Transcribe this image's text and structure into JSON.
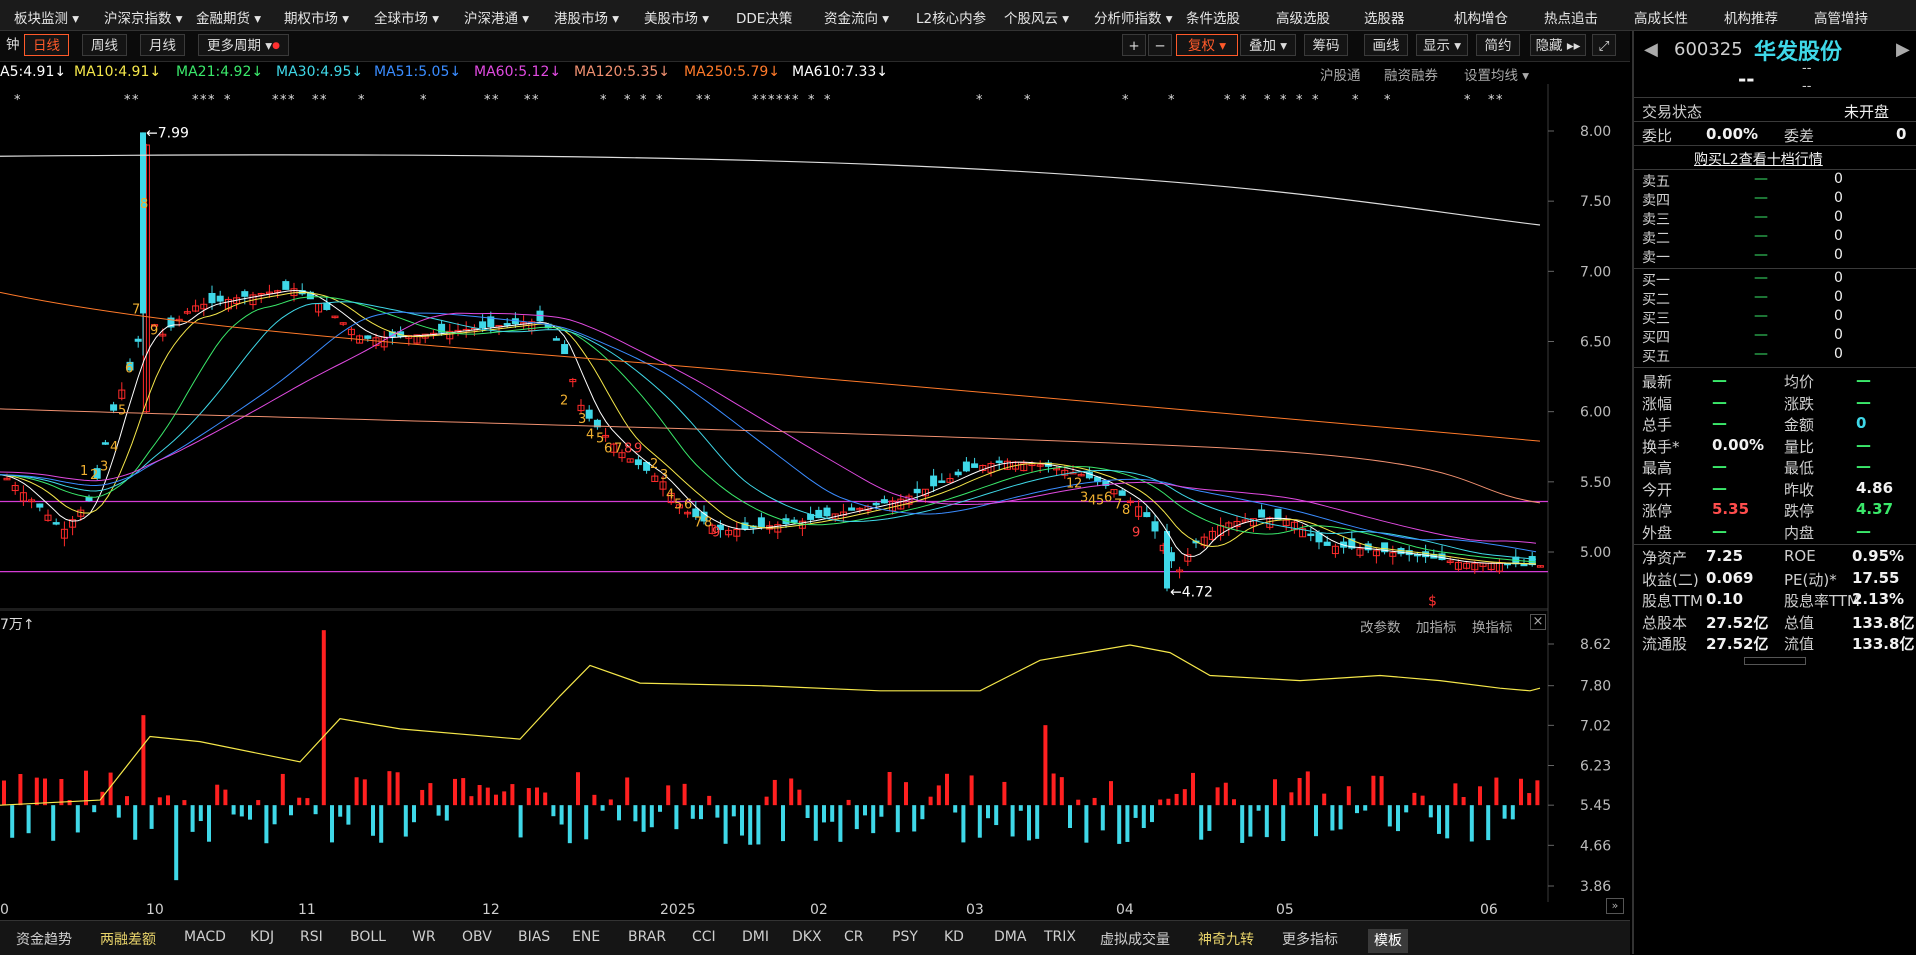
{
  "top_menu": [
    "板块监测",
    "沪深京指数",
    "金融期货",
    "期权市场",
    "全球市场",
    "沪深港通",
    "港股市场",
    "美股市场",
    "DDE决策",
    "资金流向",
    "L2核心内参",
    "个股风云",
    "分析师指数",
    "条件选股",
    "高级选股",
    "选股器",
    "机构增仓",
    "热点追击",
    "高成长性",
    "机构推荐",
    "高管增持"
  ],
  "period_bar": {
    "cut_label": "钟",
    "day": "日线",
    "week": "周线",
    "month": "月线",
    "more": "更多周期",
    "plus": "+",
    "minus": "−",
    "fuquan": "复权",
    "overlay": "叠加",
    "chips": "筹码",
    "draw": "画线",
    "display": "显示",
    "simple": "简约",
    "hide": "隐藏",
    "expand_icon": "expand-icon"
  },
  "ma_legend": [
    {
      "text": "A5:4.91↓",
      "color": "#ffffff"
    },
    {
      "text": "MA10:4.91↓",
      "color": "#f5e74a"
    },
    {
      "text": "MA21:4.92↓",
      "color": "#3ae86a"
    },
    {
      "text": "MA30:4.95↓",
      "color": "#3fd8e8"
    },
    {
      "text": "MA51:5.05↓",
      "color": "#3a8cff"
    },
    {
      "text": "MA60:5.12↓",
      "color": "#e04ae0"
    },
    {
      "text": "MA120:5.35↓",
      "color": "#f09070"
    },
    {
      "text": "MA250:5.79↓",
      "color": "#ff7a2a"
    },
    {
      "text": "MA610:7.33↓",
      "color": "#ffffff"
    }
  ],
  "chart_links": {
    "hkconnect": "沪股通",
    "margin": "融资融券",
    "set_ma": "设置均线"
  },
  "main_chart": {
    "y_ticks": [
      "8.00",
      "7.50",
      "7.00",
      "6.50",
      "6.00",
      "5.50",
      "5.00"
    ],
    "high_label": "←7.99",
    "low_label": "←4.72",
    "s_marker": "$"
  },
  "sub_chart": {
    "title": "7万↑",
    "y_ticks": [
      "8.62",
      "7.80",
      "7.02",
      "6.23",
      "5.45",
      "4.66",
      "3.86"
    ],
    "params": "改参数",
    "add_indicator": "加指标",
    "switch_indicator": "换指标",
    "close": "×"
  },
  "x_axis": [
    "0",
    "10",
    "11",
    "12",
    "2025",
    "02",
    "03",
    "04",
    "05",
    "06"
  ],
  "bottom_tabs": [
    "资金趋势",
    "两融差额",
    "MACD",
    "KDJ",
    "RSI",
    "BOLL",
    "WR",
    "OBV",
    "BIAS",
    "ENE",
    "BRAR",
    "CCI",
    "DMI",
    "DKX",
    "CR",
    "PSY",
    "KD",
    "DMA",
    "TRIX",
    "虚拟成交量",
    "神奇九转",
    "更多指标",
    "模板"
  ],
  "stock": {
    "code": "600325",
    "name": "华发股份",
    "price": "--",
    "change": "--",
    "pct": "--",
    "trade_status_label": "交易状态",
    "trade_status": "未开盘",
    "weibi_label": "委比",
    "weibi": "0.00%",
    "weicha_label": "委差",
    "weicha": "0",
    "buy_l2": "购买L2查看十档行情",
    "sell_levels": [
      {
        "label": "卖五",
        "price": "—",
        "vol": "0"
      },
      {
        "label": "卖四",
        "price": "—",
        "vol": "0"
      },
      {
        "label": "卖三",
        "price": "—",
        "vol": "0"
      },
      {
        "label": "卖二",
        "price": "—",
        "vol": "0"
      },
      {
        "label": "卖一",
        "price": "—",
        "vol": "0"
      }
    ],
    "buy_levels": [
      {
        "label": "买一",
        "price": "—",
        "vol": "0"
      },
      {
        "label": "买二",
        "price": "—",
        "vol": "0"
      },
      {
        "label": "买三",
        "price": "—",
        "vol": "0"
      },
      {
        "label": "买四",
        "price": "—",
        "vol": "0"
      },
      {
        "label": "买五",
        "price": "—",
        "vol": "0"
      }
    ],
    "stats": [
      {
        "l1": "最新",
        "v1": "—",
        "l2": "均价",
        "v2": "—"
      },
      {
        "l1": "涨幅",
        "v1": "—",
        "l2": "涨跌",
        "v2": "—"
      },
      {
        "l1": "总手",
        "v1": "—",
        "l2": "金额",
        "v2": "0"
      },
      {
        "l1": "换手*",
        "v1": "0.00%",
        "l2": "量比",
        "v2": "—"
      },
      {
        "l1": "最高",
        "v1": "—",
        "l2": "最低",
        "v2": "—"
      },
      {
        "l1": "今开",
        "v1": "—",
        "l2": "昨收",
        "v2": "4.86"
      },
      {
        "l1": "涨停",
        "v1": "5.35",
        "l2": "跌停",
        "v2": "4.37"
      },
      {
        "l1": "外盘",
        "v1": "—",
        "l2": "内盘",
        "v2": "—"
      }
    ],
    "fin": [
      {
        "l1": "净资产",
        "v1": "7.25",
        "l2": "ROE",
        "v2": "0.95%"
      },
      {
        "l1": "收益(二)",
        "v1": "0.069",
        "l2": "PE(动)*",
        "v2": "17.55"
      },
      {
        "l1": "股息TTM",
        "v1": "0.10",
        "l2": "股息率TTM",
        "v2": "2.13%"
      },
      {
        "l1": "总股本",
        "v1": "27.52亿",
        "l2": "总值",
        "v2": "133.8亿"
      },
      {
        "l1": "流通股",
        "v1": "27.52亿",
        "l2": "流值",
        "v2": "133.8亿"
      }
    ]
  },
  "colors": {
    "up": "#ff2a2a",
    "down": "#3fd8e8",
    "accent": "#ff5a2a",
    "support": "#d43cd4"
  }
}
